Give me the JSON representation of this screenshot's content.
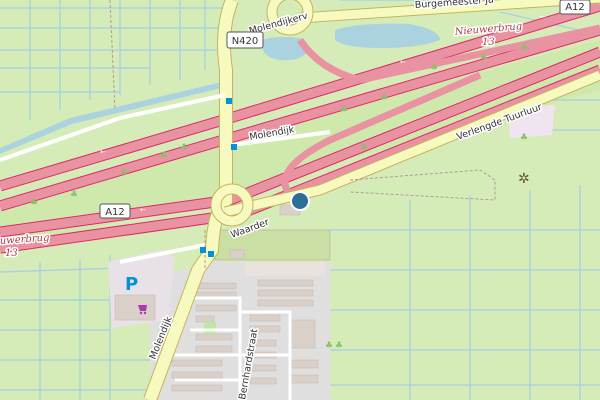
{
  "map": {
    "labels": {
      "burgemeester": "Burgemeester Ja",
      "molendijk_top": "Molendijkerv",
      "n420": "N420",
      "a12_top": "A12",
      "a12_left": "A12",
      "nieuwerbrug_right": "Nieuwerbrug",
      "nieuwerbrug_right_num": "13",
      "nieuwerbrug_left": "uwerbrug",
      "nieuwerbrug_left_num": "13",
      "molendijk_mid": "Molendijk",
      "molendijk_bottom": "Molendijk",
      "verlengde": "Verlengde Tuurluur",
      "waarder": "Waarder",
      "bernhardstraat": "Bernhardstraat",
      "parking": "P"
    },
    "colors": {
      "motorway": "#e892a2",
      "motorway_casing": "#dc2a67",
      "primary": "#fcd6a4",
      "secondary": "#f7fabf",
      "water": "#aad3df",
      "grass": "#cdebb0",
      "farmland": "#eef0d5",
      "residential": "#e0dfdf",
      "building": "#d9d0c9",
      "bus_stop": "#0092da",
      "marker": "#2b6f94"
    },
    "icons": [
      "parking-icon",
      "shop-icon",
      "bus-stop-icon",
      "location-marker-icon",
      "viewpoint-icon"
    ]
  }
}
